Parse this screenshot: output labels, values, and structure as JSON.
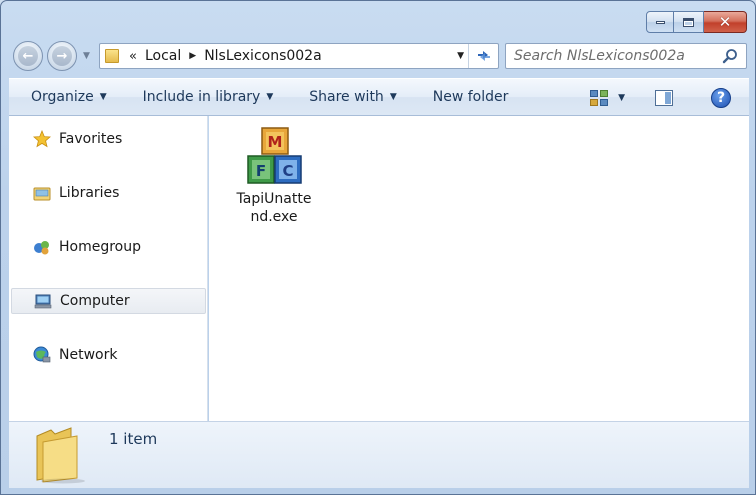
{
  "window": {
    "caption_buttons": [
      "minimize",
      "maximize",
      "close"
    ]
  },
  "address": {
    "overflow_glyph": "«",
    "crumbs": [
      "Local",
      "NlsLexicons002a"
    ]
  },
  "search": {
    "placeholder": "Search NlsLexicons002a"
  },
  "toolbar": {
    "organize": "Organize",
    "include_in_library": "Include in library",
    "share_with": "Share with",
    "new_folder": "New folder",
    "help_glyph": "?"
  },
  "sidebar": {
    "items": [
      {
        "label": "Favorites",
        "icon": "star-icon"
      },
      {
        "label": "Libraries",
        "icon": "libraries-icon"
      },
      {
        "label": "Homegroup",
        "icon": "homegroup-icon"
      },
      {
        "label": "Computer",
        "icon": "computer-icon",
        "selected": true
      },
      {
        "label": "Network",
        "icon": "network-icon"
      }
    ]
  },
  "files": [
    {
      "name": "TapiUnattend.exe",
      "icon": "mfc-blocks-icon",
      "icon_letters": [
        "M",
        "F",
        "C"
      ]
    }
  ],
  "details": {
    "count_text": "1 item"
  },
  "colors": {
    "accent": "#1e395b",
    "window_chrome": "#c9dcf1",
    "close_button": "#c1402b"
  }
}
